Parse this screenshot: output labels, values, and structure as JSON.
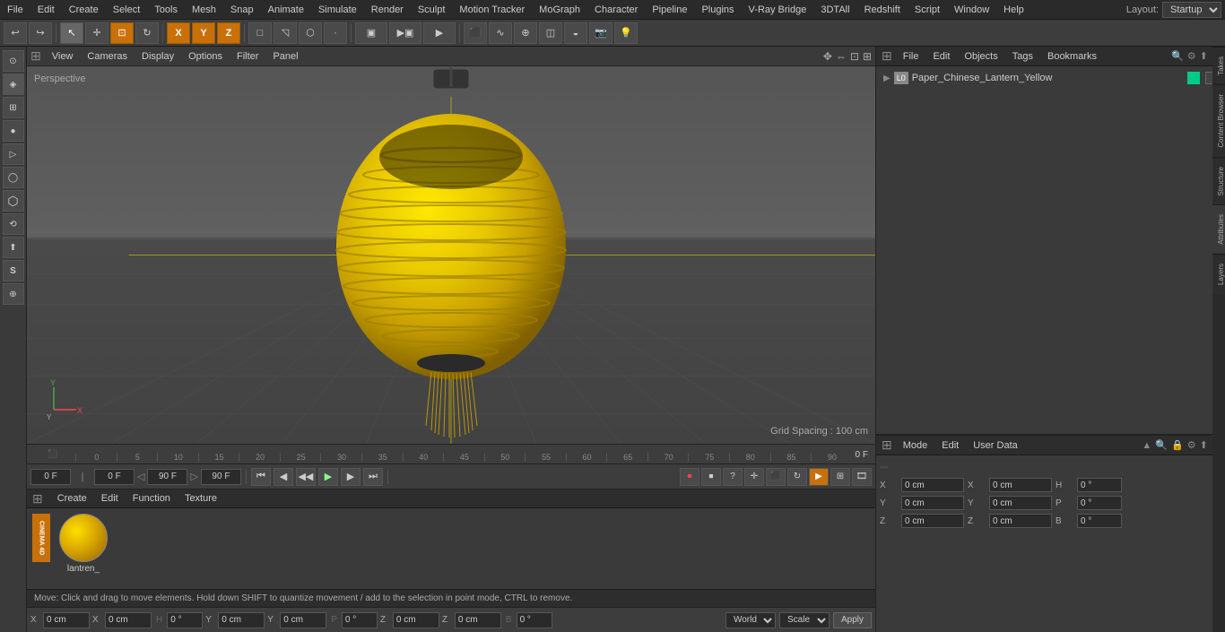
{
  "menubar": {
    "items": [
      "File",
      "Edit",
      "Create",
      "Select",
      "Tools",
      "Mesh",
      "Snap",
      "Animate",
      "Simulate",
      "Render",
      "Sculpt",
      "Motion Tracker",
      "MoGraph",
      "Character",
      "Pipeline",
      "Plugins",
      "V-Ray Bridge",
      "3DTAll",
      "Redshift",
      "Script",
      "Window",
      "Help"
    ],
    "layout_label": "Layout:",
    "layout_value": "Startup"
  },
  "toolbar": {
    "undo_icon": "↩",
    "redo_icon": "↪",
    "select_icon": "↖",
    "move_icon": "✛",
    "scale_icon": "⊡",
    "rotate_icon": "↻",
    "x_axis": "X",
    "y_axis": "Y",
    "z_axis": "Z",
    "object_mode": "□",
    "render_icon": "▶",
    "camera_icon": "📷",
    "light_icon": "💡"
  },
  "viewport": {
    "perspective_label": "Perspective",
    "header_items": [
      "View",
      "Cameras",
      "Display",
      "Options",
      "Filter",
      "Panel"
    ],
    "grid_spacing": "Grid Spacing : 100 cm"
  },
  "timeline": {
    "start_frame": "0 F",
    "end_frame": "90 F",
    "markers": [
      "0",
      "5",
      "10",
      "15",
      "20",
      "25",
      "30",
      "35",
      "40",
      "45",
      "50",
      "55",
      "60",
      "65",
      "70",
      "75",
      "80",
      "85",
      "90"
    ],
    "frame_indicator": "0 F"
  },
  "playback": {
    "current_frame": "0 F",
    "start_frame": "0 F",
    "end_frame": "90 F",
    "fps_frame": "90 F"
  },
  "object_manager": {
    "header_items": [
      "File",
      "Edit",
      "Objects",
      "Tags",
      "Bookmarks"
    ],
    "object_name": "Paper_Chinese_Lantern_Yellow",
    "object_color": "#00cc88"
  },
  "attributes": {
    "header_items": [
      "Mode",
      "Edit",
      "User Data"
    ],
    "coord_x_label": "X",
    "coord_y_label": "Y",
    "coord_z_label": "Z",
    "coord_x_val": "0 cm",
    "coord_y_val": "0 cm",
    "coord_z_val": "0 cm",
    "coord_x2_val": "0 cm",
    "coord_y2_val": "0 cm",
    "coord_z2_val": "0 cm",
    "h_label": "H",
    "p_label": "P",
    "b_label": "B",
    "h_val": "0 °",
    "p_val": "0 °",
    "b_val": "0 °",
    "dashes": "---"
  },
  "material": {
    "header_items": [
      "Create",
      "Edit",
      "Function",
      "Texture"
    ],
    "mat_name": "lantren_"
  },
  "transform_bar": {
    "world_label": "World",
    "scale_label": "Scale",
    "apply_label": "Apply"
  },
  "status_bar": {
    "message": "Move: Click and drag to move elements. Hold down SHIFT to quantize movement / add to the selection in point mode, CTRL to remove."
  },
  "left_tools": [
    "⊙",
    "◈",
    "⊞",
    "⊙",
    "▷",
    "◯",
    "⬡",
    "⟲",
    "⬆",
    "S",
    "⊕"
  ],
  "right_tabs": [
    "Takes",
    "Content Browser",
    "Structure",
    "Attributes",
    "Layers"
  ],
  "axis": {
    "x_color": "#ff4444",
    "y_color": "#44ff44",
    "label": "Y"
  }
}
